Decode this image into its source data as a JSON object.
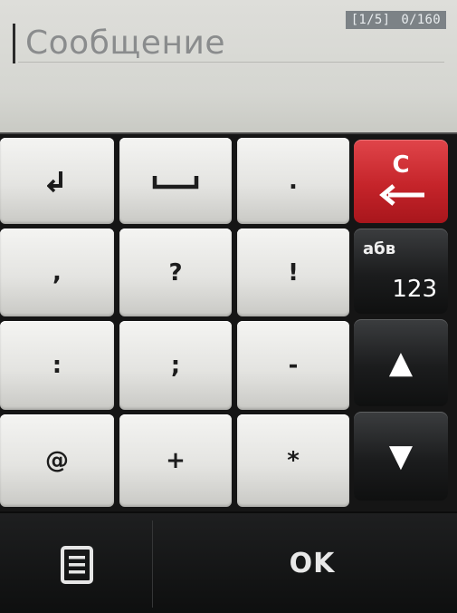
{
  "compose": {
    "placeholder": "Сообщение",
    "page_indicator": "[1/5]",
    "char_counter": "0/160"
  },
  "keypad": {
    "keys": [
      {
        "name": "key-enter",
        "label": "↲"
      },
      {
        "name": "key-space",
        "label": "␣"
      },
      {
        "name": "key-period",
        "label": "."
      },
      {
        "name": "key-comma",
        "label": ","
      },
      {
        "name": "key-question",
        "label": "?"
      },
      {
        "name": "key-exclamation",
        "label": "!"
      },
      {
        "name": "key-colon",
        "label": ":"
      },
      {
        "name": "key-semicolon",
        "label": ";"
      },
      {
        "name": "key-minus",
        "label": "-"
      },
      {
        "name": "key-at",
        "label": "@"
      },
      {
        "name": "key-plus",
        "label": "+"
      },
      {
        "name": "key-asterisk",
        "label": "*"
      }
    ],
    "clear_label": "C",
    "mode_letters": "абв",
    "mode_digits": "123",
    "scroll_up_icon": "▲",
    "scroll_down_icon": "▼"
  },
  "softkeys": {
    "ok_label": "OK",
    "menu_icon": "list-menu-icon"
  },
  "colors": {
    "clear_key": "#c5242a",
    "counter_bg": "#7c8286",
    "key_face": "#e4e4e1",
    "dark_key": "#1b1c1d"
  }
}
